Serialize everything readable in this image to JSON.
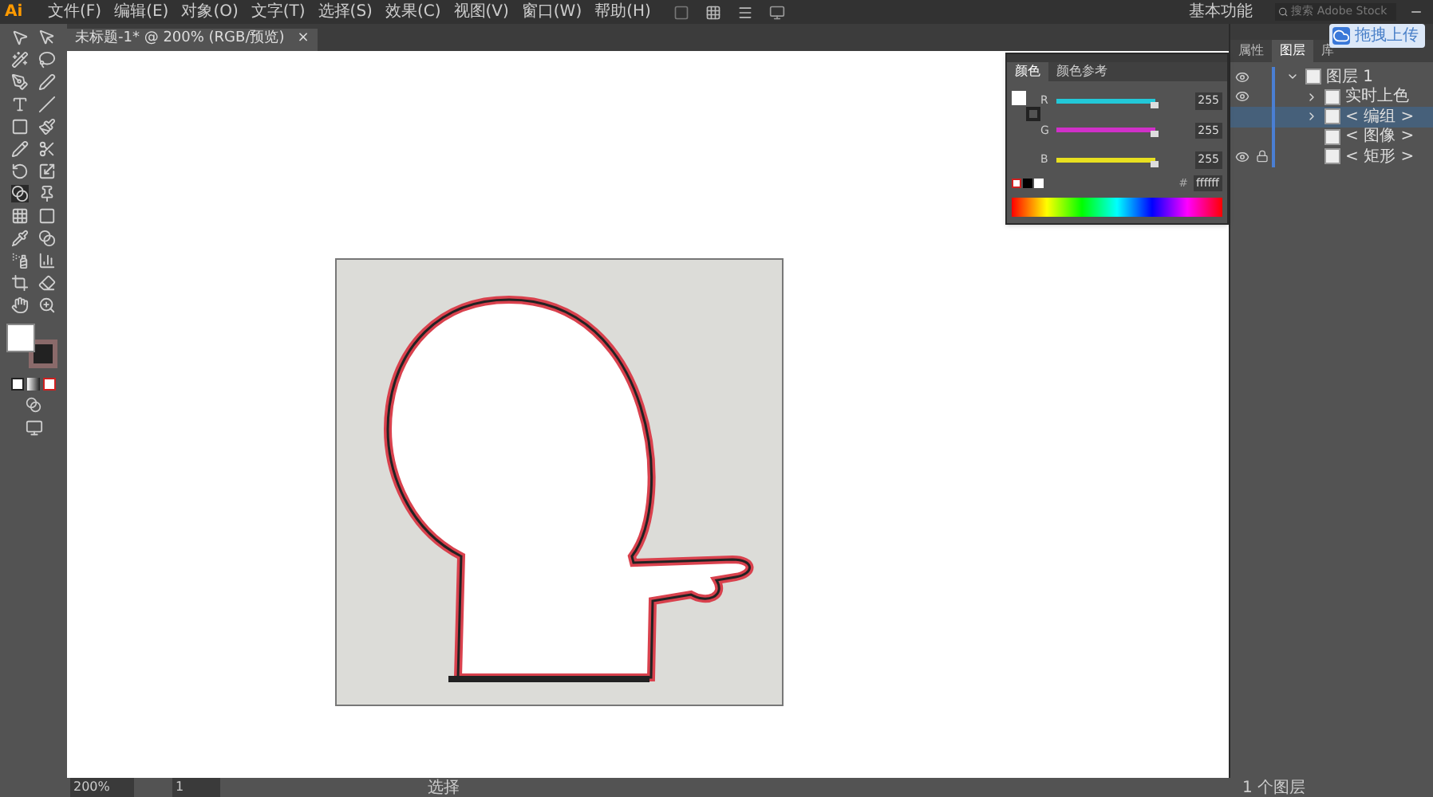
{
  "menu_bar": {
    "logo": "Ai",
    "items": [
      "文件(F)",
      "编辑(E)",
      "对象(O)",
      "文字(T)",
      "选择(S)",
      "效果(C)",
      "视图(V)",
      "窗口(W)",
      "帮助(H)"
    ],
    "workspace": "基本功能",
    "search": {
      "placeholder": "搜索 Adobe Stock"
    }
  },
  "upload_button": "拖拽上传",
  "document_tab": {
    "title": "未标题-1* @ 200% (RGB/预览)",
    "close": "×"
  },
  "color_panel": {
    "tabs": [
      {
        "label": "颜色",
        "selected": true
      },
      {
        "label": "颜色参考",
        "selected": false
      }
    ],
    "channels": [
      {
        "name": "R",
        "level": 1,
        "value": "255",
        "color": "#22c8d8"
      },
      {
        "name": "G",
        "level": 1,
        "value": "255",
        "color": "#d030c8"
      },
      {
        "name": "B",
        "level": 1,
        "value": "255",
        "color": "#e8e020"
      }
    ],
    "hex_label": "#",
    "hex": "ffffff"
  },
  "right_panel": {
    "tabs": [
      {
        "label": "属性",
        "selected": false
      },
      {
        "label": "图层",
        "selected": true
      },
      {
        "label": "库",
        "selected": false
      }
    ],
    "layers": [
      {
        "name": "图层 1",
        "visible": true,
        "locked": false,
        "selected": false,
        "expanded": true,
        "children": [
          {
            "name": "实时上色",
            "visible": true,
            "locked": false,
            "selected": false,
            "expanded": false
          },
          {
            "name": "< 编组 >",
            "visible": false,
            "locked": false,
            "selected": true,
            "expanded": false
          },
          {
            "name": "< 图像 >",
            "visible": false,
            "locked": false,
            "selected": false
          },
          {
            "name": "< 矩形 >",
            "visible": true,
            "locked": true,
            "selected": false
          }
        ]
      }
    ]
  },
  "status_bar": {
    "zoom": "200%",
    "artboard": "1",
    "tool": "选择",
    "layer_count": "1 个图层"
  }
}
